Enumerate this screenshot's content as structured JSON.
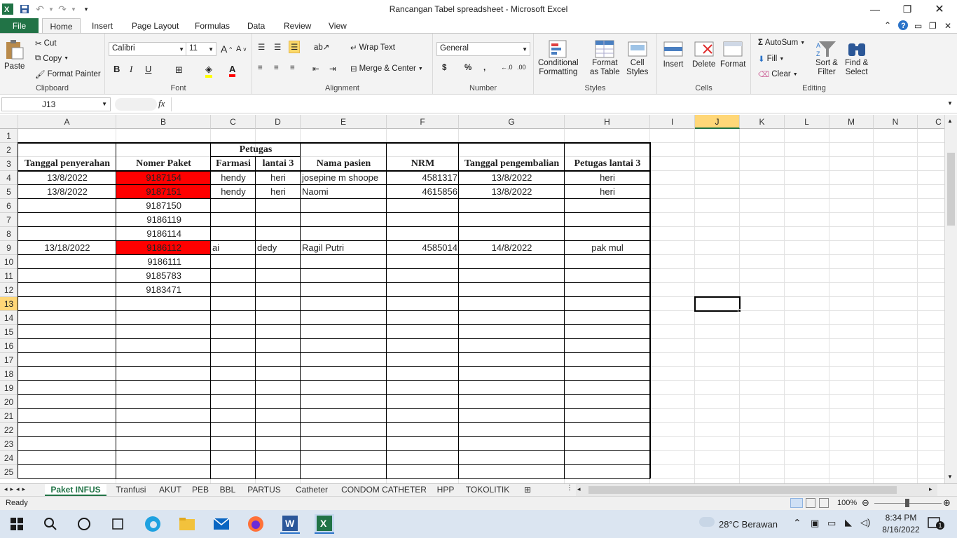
{
  "window": {
    "title": "Rancangan Tabel spreadsheet  -  Microsoft Excel"
  },
  "tabs": {
    "file": "File",
    "home": "Home",
    "insert": "Insert",
    "page_layout": "Page Layout",
    "formulas": "Formulas",
    "data": "Data",
    "review": "Review",
    "view": "View"
  },
  "clipboard": {
    "paste": "Paste",
    "cut": "Cut",
    "copy": "Copy",
    "format_painter": "Format Painter",
    "label": "Clipboard"
  },
  "font": {
    "name": "Calibri",
    "size": "11",
    "label": "Font"
  },
  "alignment": {
    "wrap_text": "Wrap Text",
    "merge_center": "Merge & Center",
    "label": "Alignment"
  },
  "number": {
    "format": "General",
    "currency": "$",
    "percent": "%",
    "comma": ",",
    "label": "Number"
  },
  "styles": {
    "conditional": "Conditional",
    "formatting": "Formatting",
    "format_as": "Format",
    "as_table": "as Table",
    "cell": "Cell",
    "styles_text": "Styles",
    "label": "Styles"
  },
  "cells": {
    "insert": "Insert",
    "delete": "Delete",
    "format": "Format",
    "label": "Cells"
  },
  "editing": {
    "autosum": "AutoSum",
    "fill": "Fill",
    "clear": "Clear",
    "sort": "Sort &",
    "filter": "Filter",
    "find": "Find &",
    "select": "Select",
    "label": "Editing"
  },
  "formula_bar": {
    "name_box": "J13",
    "fx": "fx",
    "formula": ""
  },
  "columns": [
    "A",
    "B",
    "C",
    "D",
    "E",
    "F",
    "G",
    "H",
    "I",
    "J",
    "K",
    "L",
    "M",
    "N",
    "C"
  ],
  "rows": [
    "1",
    "2",
    "3",
    "4",
    "5",
    "6",
    "7",
    "8",
    "9",
    "10",
    "11",
    "12",
    "13",
    "14",
    "15",
    "16",
    "17",
    "18",
    "19",
    "20",
    "21",
    "22",
    "23",
    "24",
    "25"
  ],
  "table": {
    "group_header": "Petugas",
    "headers": [
      "Tanggal penyerahan",
      "Nomer Paket",
      "Farmasi",
      "lantai 3",
      "Nama pasien",
      "NRM",
      "Tanggal pengembalian",
      "Petugas lantai 3"
    ],
    "rows": [
      {
        "a": "13/8/2022",
        "b": "9187154",
        "c": "hendy",
        "d": "heri",
        "e": "josepine m shoope",
        "f": "4581317",
        "g": "13/8/2022",
        "h": "heri",
        "highlight": true
      },
      {
        "a": "13/8/2022",
        "b": "9187151",
        "c": "hendy",
        "d": "heri",
        "e": "Naomi",
        "f": "4615856",
        "g": "13/8/2022",
        "h": "heri",
        "highlight": true
      },
      {
        "a": "",
        "b": "9187150",
        "c": "",
        "d": "",
        "e": "",
        "f": "",
        "g": "",
        "h": "",
        "highlight": false
      },
      {
        "a": "",
        "b": "9186119",
        "c": "",
        "d": "",
        "e": "",
        "f": "",
        "g": "",
        "h": "",
        "highlight": false
      },
      {
        "a": "",
        "b": "9186114",
        "c": "",
        "d": "",
        "e": "",
        "f": "",
        "g": "",
        "h": "",
        "highlight": false
      },
      {
        "a": "13/18/2022",
        "b": "9186112",
        "c": "ai",
        "d": "dedy",
        "e": "Ragil Putri",
        "f": "4585014",
        "g": "14/8/2022",
        "h": "pak mul",
        "highlight": true
      },
      {
        "a": "",
        "b": "9186111",
        "c": "",
        "d": "",
        "e": "",
        "f": "",
        "g": "",
        "h": "",
        "highlight": false
      },
      {
        "a": "",
        "b": "9185783",
        "c": "",
        "d": "",
        "e": "",
        "f": "",
        "g": "",
        "h": "",
        "highlight": false
      },
      {
        "a": "",
        "b": "9183471",
        "c": "",
        "d": "",
        "e": "",
        "f": "",
        "g": "",
        "h": "",
        "highlight": false
      }
    ]
  },
  "sheet_tabs": [
    "Paket INFUS",
    "Tranfusi",
    "AKUT",
    "PEB",
    "BBL",
    "PARTUS",
    "Catheter",
    "CONDOM CATHETER",
    "HPP",
    "TOKOLITIK"
  ],
  "status": {
    "ready": "Ready",
    "zoom": "100%"
  },
  "taskbar": {
    "weather": "28°C  Berawan",
    "time": "8:34 PM",
    "date": "8/16/2022",
    "notifications": "1"
  },
  "colors": {
    "excel_green": "#217346",
    "highlight_red": "#ff0000",
    "selected_header": "#ffd778"
  }
}
